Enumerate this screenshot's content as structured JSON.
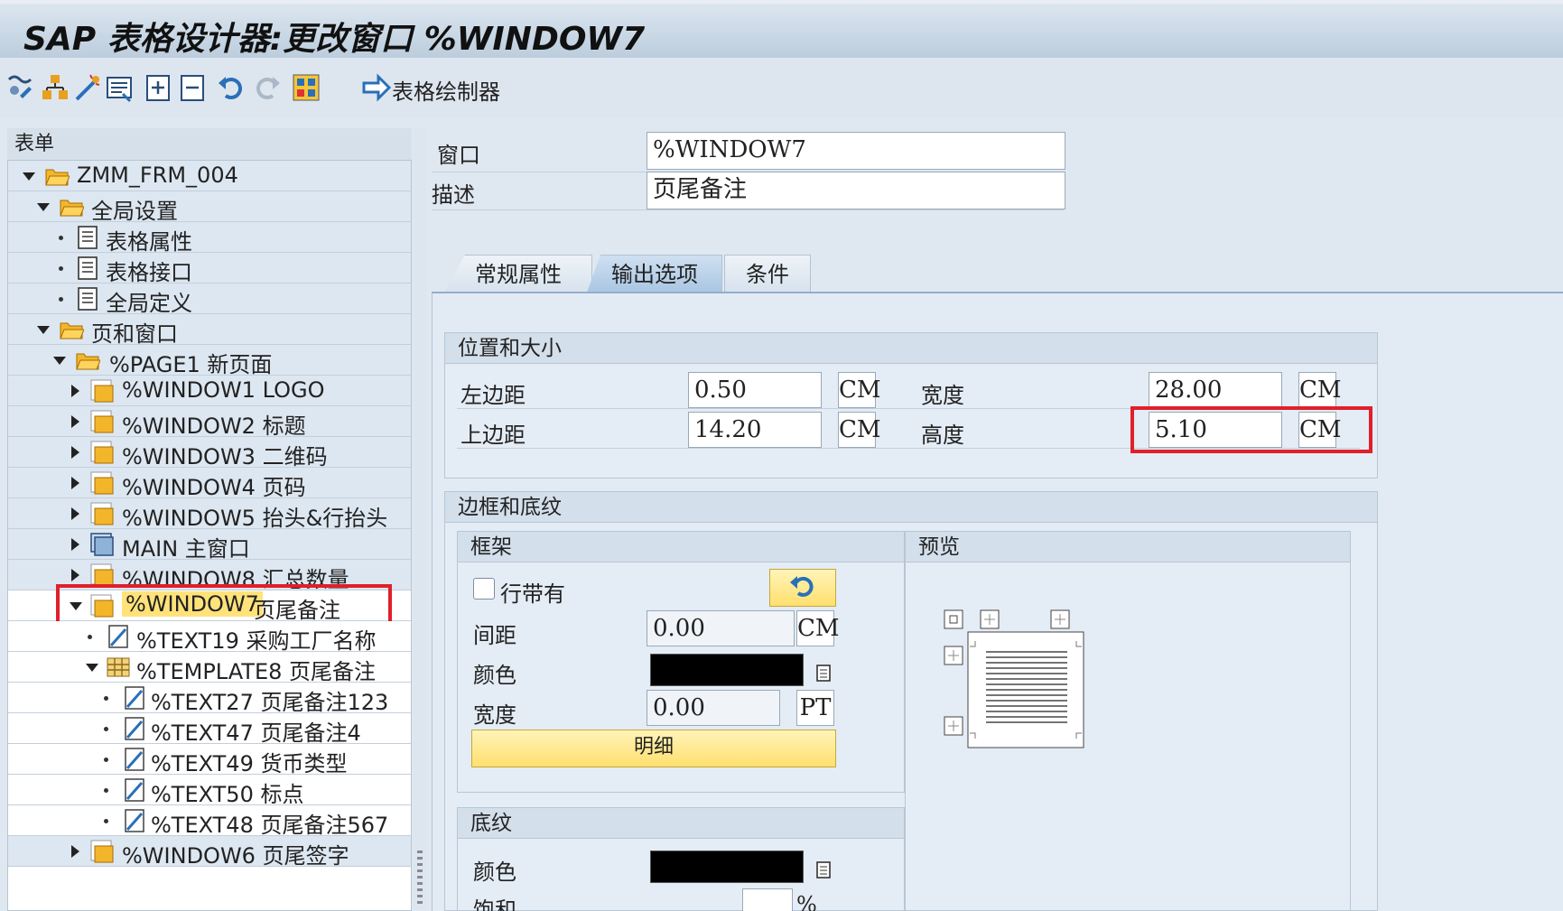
{
  "title": "SAP 表格设计器:更改窗口 %WINDOW7",
  "toolbar": {
    "icons": [
      "display-change-icon",
      "hierarchy-icon",
      "wizard-icon",
      "print-preview-icon",
      "insert-icon",
      "delete-icon",
      "undo-icon",
      "redo-icon",
      "form-painter-icon",
      "forward-arrow-icon"
    ],
    "form_painter_label": "表格绘制器"
  },
  "tree": {
    "header": "表单",
    "items": [
      {
        "label": "ZMM_FRM_004"
      },
      {
        "label": "全局设置"
      },
      {
        "label": "表格属性"
      },
      {
        "label": "表格接口"
      },
      {
        "label": "全局定义"
      },
      {
        "label": "页和窗口"
      },
      {
        "label": "%PAGE1 新页面"
      },
      {
        "label": "%WINDOW1 LOGO"
      },
      {
        "label": "%WINDOW2 标题"
      },
      {
        "label": "%WINDOW3 二维码"
      },
      {
        "label": "%WINDOW4 页码"
      },
      {
        "label": "%WINDOW5 抬头&行抬头"
      },
      {
        "label": "MAIN 主窗口"
      },
      {
        "label": "%WINDOW8 汇总数量"
      },
      {
        "label_code": "%WINDOW7",
        "label_desc": " 页尾备注"
      },
      {
        "label": "%TEXT19 采购工厂名称"
      },
      {
        "label": "%TEMPLATE8 页尾备注"
      },
      {
        "label": "%TEXT27 页尾备注123"
      },
      {
        "label": "%TEXT47 页尾备注4"
      },
      {
        "label": "%TEXT49 货币类型"
      },
      {
        "label": "%TEXT50 标点"
      },
      {
        "label": "%TEXT48 页尾备注567"
      },
      {
        "label": "%WINDOW6 页尾签字"
      }
    ]
  },
  "header_fields": {
    "window_label": "窗口",
    "window_value": "%WINDOW7",
    "desc_label": "描述",
    "desc_value": "页尾备注"
  },
  "tabs": [
    "常规属性",
    "输出选项",
    "条件"
  ],
  "active_tab": "输出选项",
  "position_size": {
    "title": "位置和大小",
    "left_margin_label": "左边距",
    "left_margin_value": "0.50",
    "left_margin_unit": "CM",
    "top_margin_label": "上边距",
    "top_margin_value": "14.20",
    "top_margin_unit": "CM",
    "width_label": "宽度",
    "width_value": "28.00",
    "width_unit": "CM",
    "height_label": "高度",
    "height_value": "5.10",
    "height_unit": "CM"
  },
  "border_shading": {
    "title": "边框和底纹",
    "frame": {
      "title": "框架",
      "line_check_label": "行带有",
      "spacing_label": "间距",
      "spacing_value": "0.00",
      "spacing_unit": "CM",
      "color_label": "颜色",
      "width_label": "宽度",
      "width_value": "0.00",
      "width_unit": "PT",
      "details_button": "明细"
    },
    "preview": {
      "title": "预览"
    },
    "shading": {
      "title": "底纹",
      "color_label": "颜色",
      "saturation_label": "饱和",
      "saturation_unit": "%"
    }
  },
  "colors": {
    "highlight": "#e0202a",
    "folder": "#f3b62b",
    "tree_row": "#dde7f1",
    "selected": "#ffe27a"
  }
}
